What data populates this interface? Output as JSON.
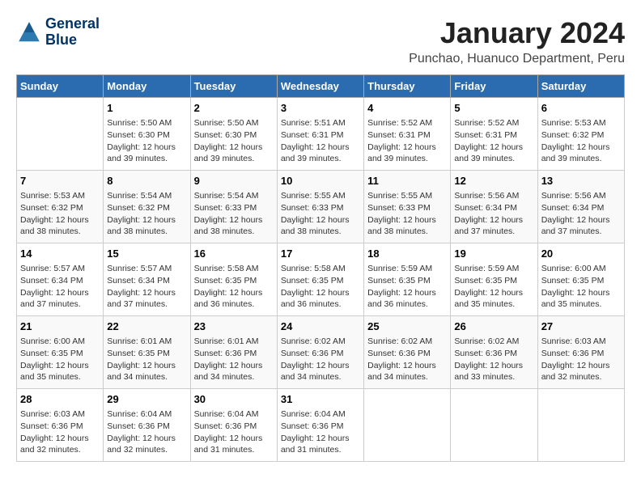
{
  "header": {
    "logo_line1": "General",
    "logo_line2": "Blue",
    "title": "January 2024",
    "subtitle": "Punchao, Huanuco Department, Peru"
  },
  "weekdays": [
    "Sunday",
    "Monday",
    "Tuesday",
    "Wednesday",
    "Thursday",
    "Friday",
    "Saturday"
  ],
  "weeks": [
    [
      {
        "day": "",
        "info": ""
      },
      {
        "day": "1",
        "info": "Sunrise: 5:50 AM\nSunset: 6:30 PM\nDaylight: 12 hours\nand 39 minutes."
      },
      {
        "day": "2",
        "info": "Sunrise: 5:50 AM\nSunset: 6:30 PM\nDaylight: 12 hours\nand 39 minutes."
      },
      {
        "day": "3",
        "info": "Sunrise: 5:51 AM\nSunset: 6:31 PM\nDaylight: 12 hours\nand 39 minutes."
      },
      {
        "day": "4",
        "info": "Sunrise: 5:52 AM\nSunset: 6:31 PM\nDaylight: 12 hours\nand 39 minutes."
      },
      {
        "day": "5",
        "info": "Sunrise: 5:52 AM\nSunset: 6:31 PM\nDaylight: 12 hours\nand 39 minutes."
      },
      {
        "day": "6",
        "info": "Sunrise: 5:53 AM\nSunset: 6:32 PM\nDaylight: 12 hours\nand 39 minutes."
      }
    ],
    [
      {
        "day": "7",
        "info": "Sunrise: 5:53 AM\nSunset: 6:32 PM\nDaylight: 12 hours\nand 38 minutes."
      },
      {
        "day": "8",
        "info": "Sunrise: 5:54 AM\nSunset: 6:32 PM\nDaylight: 12 hours\nand 38 minutes."
      },
      {
        "day": "9",
        "info": "Sunrise: 5:54 AM\nSunset: 6:33 PM\nDaylight: 12 hours\nand 38 minutes."
      },
      {
        "day": "10",
        "info": "Sunrise: 5:55 AM\nSunset: 6:33 PM\nDaylight: 12 hours\nand 38 minutes."
      },
      {
        "day": "11",
        "info": "Sunrise: 5:55 AM\nSunset: 6:33 PM\nDaylight: 12 hours\nand 38 minutes."
      },
      {
        "day": "12",
        "info": "Sunrise: 5:56 AM\nSunset: 6:34 PM\nDaylight: 12 hours\nand 37 minutes."
      },
      {
        "day": "13",
        "info": "Sunrise: 5:56 AM\nSunset: 6:34 PM\nDaylight: 12 hours\nand 37 minutes."
      }
    ],
    [
      {
        "day": "14",
        "info": "Sunrise: 5:57 AM\nSunset: 6:34 PM\nDaylight: 12 hours\nand 37 minutes."
      },
      {
        "day": "15",
        "info": "Sunrise: 5:57 AM\nSunset: 6:34 PM\nDaylight: 12 hours\nand 37 minutes."
      },
      {
        "day": "16",
        "info": "Sunrise: 5:58 AM\nSunset: 6:35 PM\nDaylight: 12 hours\nand 36 minutes."
      },
      {
        "day": "17",
        "info": "Sunrise: 5:58 AM\nSunset: 6:35 PM\nDaylight: 12 hours\nand 36 minutes."
      },
      {
        "day": "18",
        "info": "Sunrise: 5:59 AM\nSunset: 6:35 PM\nDaylight: 12 hours\nand 36 minutes."
      },
      {
        "day": "19",
        "info": "Sunrise: 5:59 AM\nSunset: 6:35 PM\nDaylight: 12 hours\nand 35 minutes."
      },
      {
        "day": "20",
        "info": "Sunrise: 6:00 AM\nSunset: 6:35 PM\nDaylight: 12 hours\nand 35 minutes."
      }
    ],
    [
      {
        "day": "21",
        "info": "Sunrise: 6:00 AM\nSunset: 6:35 PM\nDaylight: 12 hours\nand 35 minutes."
      },
      {
        "day": "22",
        "info": "Sunrise: 6:01 AM\nSunset: 6:35 PM\nDaylight: 12 hours\nand 34 minutes."
      },
      {
        "day": "23",
        "info": "Sunrise: 6:01 AM\nSunset: 6:36 PM\nDaylight: 12 hours\nand 34 minutes."
      },
      {
        "day": "24",
        "info": "Sunrise: 6:02 AM\nSunset: 6:36 PM\nDaylight: 12 hours\nand 34 minutes."
      },
      {
        "day": "25",
        "info": "Sunrise: 6:02 AM\nSunset: 6:36 PM\nDaylight: 12 hours\nand 34 minutes."
      },
      {
        "day": "26",
        "info": "Sunrise: 6:02 AM\nSunset: 6:36 PM\nDaylight: 12 hours\nand 33 minutes."
      },
      {
        "day": "27",
        "info": "Sunrise: 6:03 AM\nSunset: 6:36 PM\nDaylight: 12 hours\nand 32 minutes."
      }
    ],
    [
      {
        "day": "28",
        "info": "Sunrise: 6:03 AM\nSunset: 6:36 PM\nDaylight: 12 hours\nand 32 minutes."
      },
      {
        "day": "29",
        "info": "Sunrise: 6:04 AM\nSunset: 6:36 PM\nDaylight: 12 hours\nand 32 minutes."
      },
      {
        "day": "30",
        "info": "Sunrise: 6:04 AM\nSunset: 6:36 PM\nDaylight: 12 hours\nand 31 minutes."
      },
      {
        "day": "31",
        "info": "Sunrise: 6:04 AM\nSunset: 6:36 PM\nDaylight: 12 hours\nand 31 minutes."
      },
      {
        "day": "",
        "info": ""
      },
      {
        "day": "",
        "info": ""
      },
      {
        "day": "",
        "info": ""
      }
    ]
  ]
}
